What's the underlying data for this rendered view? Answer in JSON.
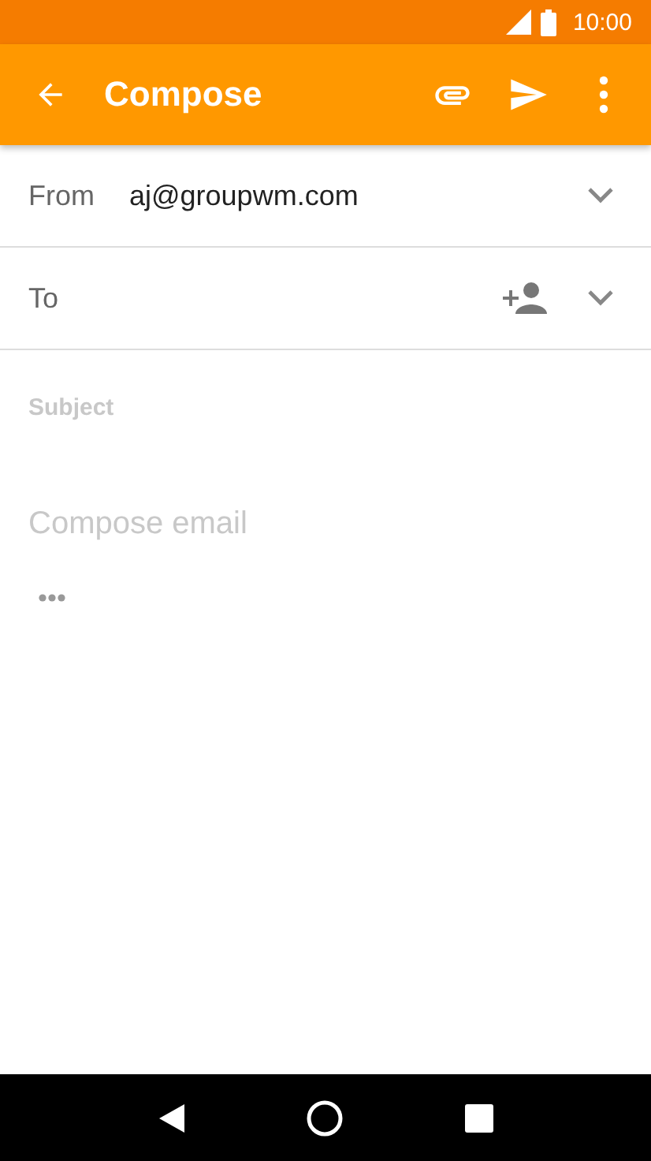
{
  "status_bar": {
    "time": "10:00"
  },
  "app_bar": {
    "title": "Compose"
  },
  "from": {
    "label": "From",
    "value": "aj@groupwm.com"
  },
  "to": {
    "label": "To"
  },
  "subject": {
    "placeholder": "Subject"
  },
  "body": {
    "placeholder": "Compose email"
  }
}
